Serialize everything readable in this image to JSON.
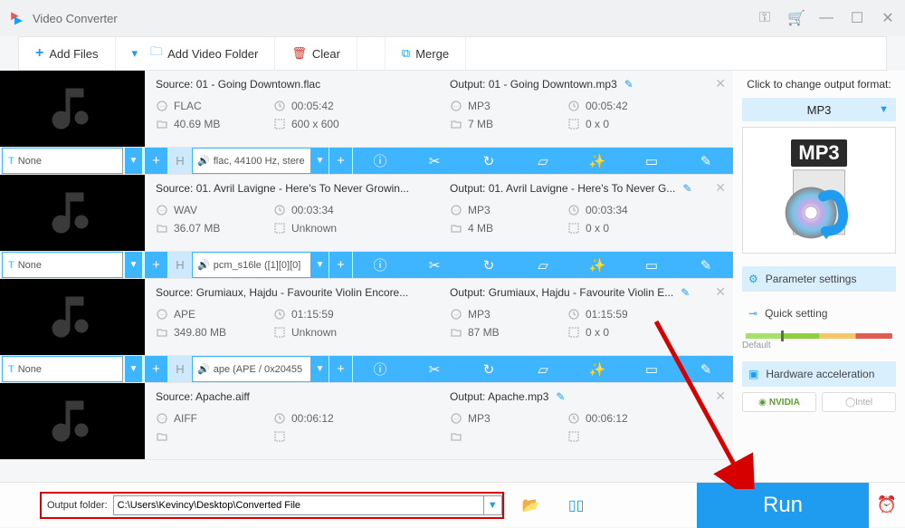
{
  "app": {
    "title": "Video Converter"
  },
  "toolbar": {
    "add_files": "Add Files",
    "add_folder": "Add Video Folder",
    "clear": "Clear",
    "merge": "Merge"
  },
  "files": [
    {
      "source_label": "Source: 01 - Going Downtown.flac",
      "output_label": "Output: 01 - Going Downtown.mp3",
      "src_codec": "FLAC",
      "src_dur": "00:05:42",
      "src_size": "40.69 MB",
      "src_dim": "600 x 600",
      "out_codec": "MP3",
      "out_dur": "00:05:42",
      "out_size": "7 MB",
      "out_dim": "0 x 0",
      "text_track": "None",
      "audio_track": "flac, 44100 Hz, stere"
    },
    {
      "source_label": "Source: 01. Avril Lavigne - Here's To Never Growin...",
      "output_label": "Output: 01. Avril Lavigne - Here's To Never G...",
      "src_codec": "WAV",
      "src_dur": "00:03:34",
      "src_size": "36.07 MB",
      "src_dim": "Unknown",
      "out_codec": "MP3",
      "out_dur": "00:03:34",
      "out_size": "4 MB",
      "out_dim": "0 x 0",
      "text_track": "None",
      "audio_track": "pcm_s16le ([1][0][0]"
    },
    {
      "source_label": "Source: Grumiaux, Hajdu - Favourite Violin Encore...",
      "output_label": "Output: Grumiaux, Hajdu - Favourite Violin E...",
      "src_codec": "APE",
      "src_dur": "01:15:59",
      "src_size": "349.80 MB",
      "src_dim": "Unknown",
      "out_codec": "MP3",
      "out_dur": "01:15:59",
      "out_size": "87 MB",
      "out_dim": "0 x 0",
      "text_track": "None",
      "audio_track": "ape (APE / 0x20455"
    },
    {
      "source_label": "Source: Apache.aiff",
      "output_label": "Output: Apache.mp3",
      "src_codec": "AIFF",
      "src_dur": "00:06:12",
      "src_size": "",
      "src_dim": "",
      "out_codec": "MP3",
      "out_dur": "00:06:12",
      "out_size": "",
      "out_dim": "",
      "text_track": "None",
      "audio_track": ""
    }
  ],
  "side": {
    "prompt": "Click to change output format:",
    "format": "MP3",
    "badge": "MP3",
    "param_btn": "Parameter settings",
    "quick_btn": "Quick setting",
    "slider_lab": "Default",
    "hw_btn": "Hardware acceleration",
    "nvidia": "NVIDIA",
    "intel": "Intel"
  },
  "bottom": {
    "label": "Output folder:",
    "path": "C:\\Users\\Kevincy\\Desktop\\Converted File",
    "run": "Run"
  }
}
